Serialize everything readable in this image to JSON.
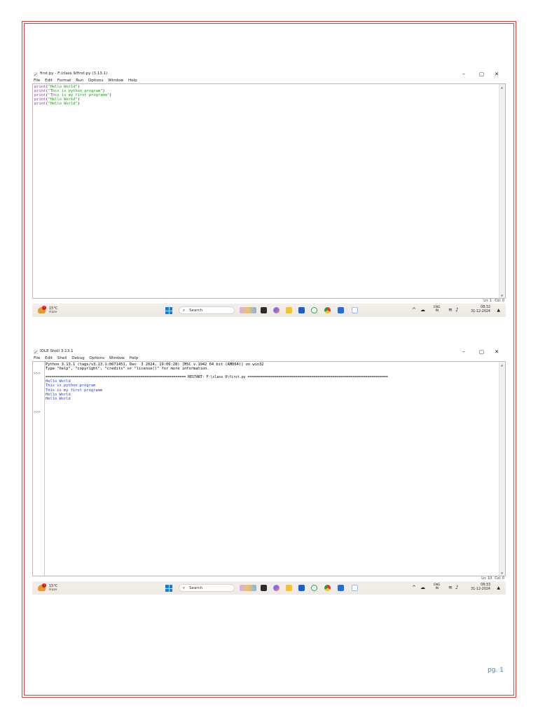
{
  "page_number": "pg. 1",
  "editor_window": {
    "title": "first.py - F:/class 9/first.py (3.13.1)",
    "menu": [
      "File",
      "Edit",
      "Format",
      "Run",
      "Options",
      "Window",
      "Help"
    ],
    "code_lines": [
      {
        "fn": "print",
        "arg": "\"Hello World\""
      },
      {
        "fn": "print",
        "arg": "\"This is python program\""
      },
      {
        "fn": "print",
        "arg": "\"This is my first programm\""
      },
      {
        "fn": "print",
        "arg": "\"Hello World\""
      },
      {
        "fn": "print",
        "arg": "\"Hello World\""
      }
    ],
    "status": {
      "line": "Ln: 1",
      "col": "Col: 0"
    },
    "window_controls": {
      "minimize": "–",
      "maximize": "▢",
      "close": "✕"
    }
  },
  "shell_window": {
    "title": "IDLE Shell 3.13.1",
    "menu": [
      "File",
      "Edit",
      "Shell",
      "Debug",
      "Options",
      "Window",
      "Help"
    ],
    "banner": [
      "Python 3.13.1 (tags/v3.13.1:0671451, Dec  3 2024, 19:06:28) [MSC v.1942 64 bit (AMD64)] on win32",
      "Type \"help\", \"copyright\", \"credits\" or \"license()\" for more information."
    ],
    "restart_line": "==================================================================== RESTART: F:\\class 9\\first.py ====================================================================",
    "output": [
      "Hello World",
      "This is python program",
      "This is my first programm",
      "Hello World",
      "Hello World"
    ],
    "prompt": ">>>",
    "status": {
      "line": "Ln: 10",
      "col": "Col: 0"
    },
    "window_controls": {
      "minimize": "–",
      "maximize": "▢",
      "close": "✕"
    }
  },
  "taskbar_top": {
    "weather": {
      "temp": "15°C",
      "condition": "Haze",
      "alert": "!"
    },
    "search_label": "Search",
    "tray": {
      "lang": "ENG",
      "region": "IN"
    },
    "clock": {
      "time": "08:32",
      "date": "31-12-2024"
    }
  },
  "taskbar_bottom": {
    "weather": {
      "temp": "15°C",
      "condition": "Haze",
      "alert": "!"
    },
    "search_label": "Search",
    "tray": {
      "lang": "ENG",
      "region": "IN"
    },
    "clock": {
      "time": "08:33",
      "date": "31-12-2024"
    }
  },
  "colors": {
    "keyword": "#9b2aa0",
    "string": "#1b9b1b",
    "output": "#1f3cd6",
    "prompt": "#8a6a3a",
    "page_border": "#e23b3b",
    "page_number": "#4a78c8"
  },
  "icons": [
    "python-idle-icon",
    "search-icon",
    "windows-logo-icon",
    "file-explorer-icon",
    "chrome-icon",
    "whatsapp-icon",
    "word-icon",
    "copilot-icon",
    "store-icon",
    "wifi-icon",
    "volume-icon",
    "bell-icon",
    "chevron-up-icon",
    "weather-icon"
  ]
}
